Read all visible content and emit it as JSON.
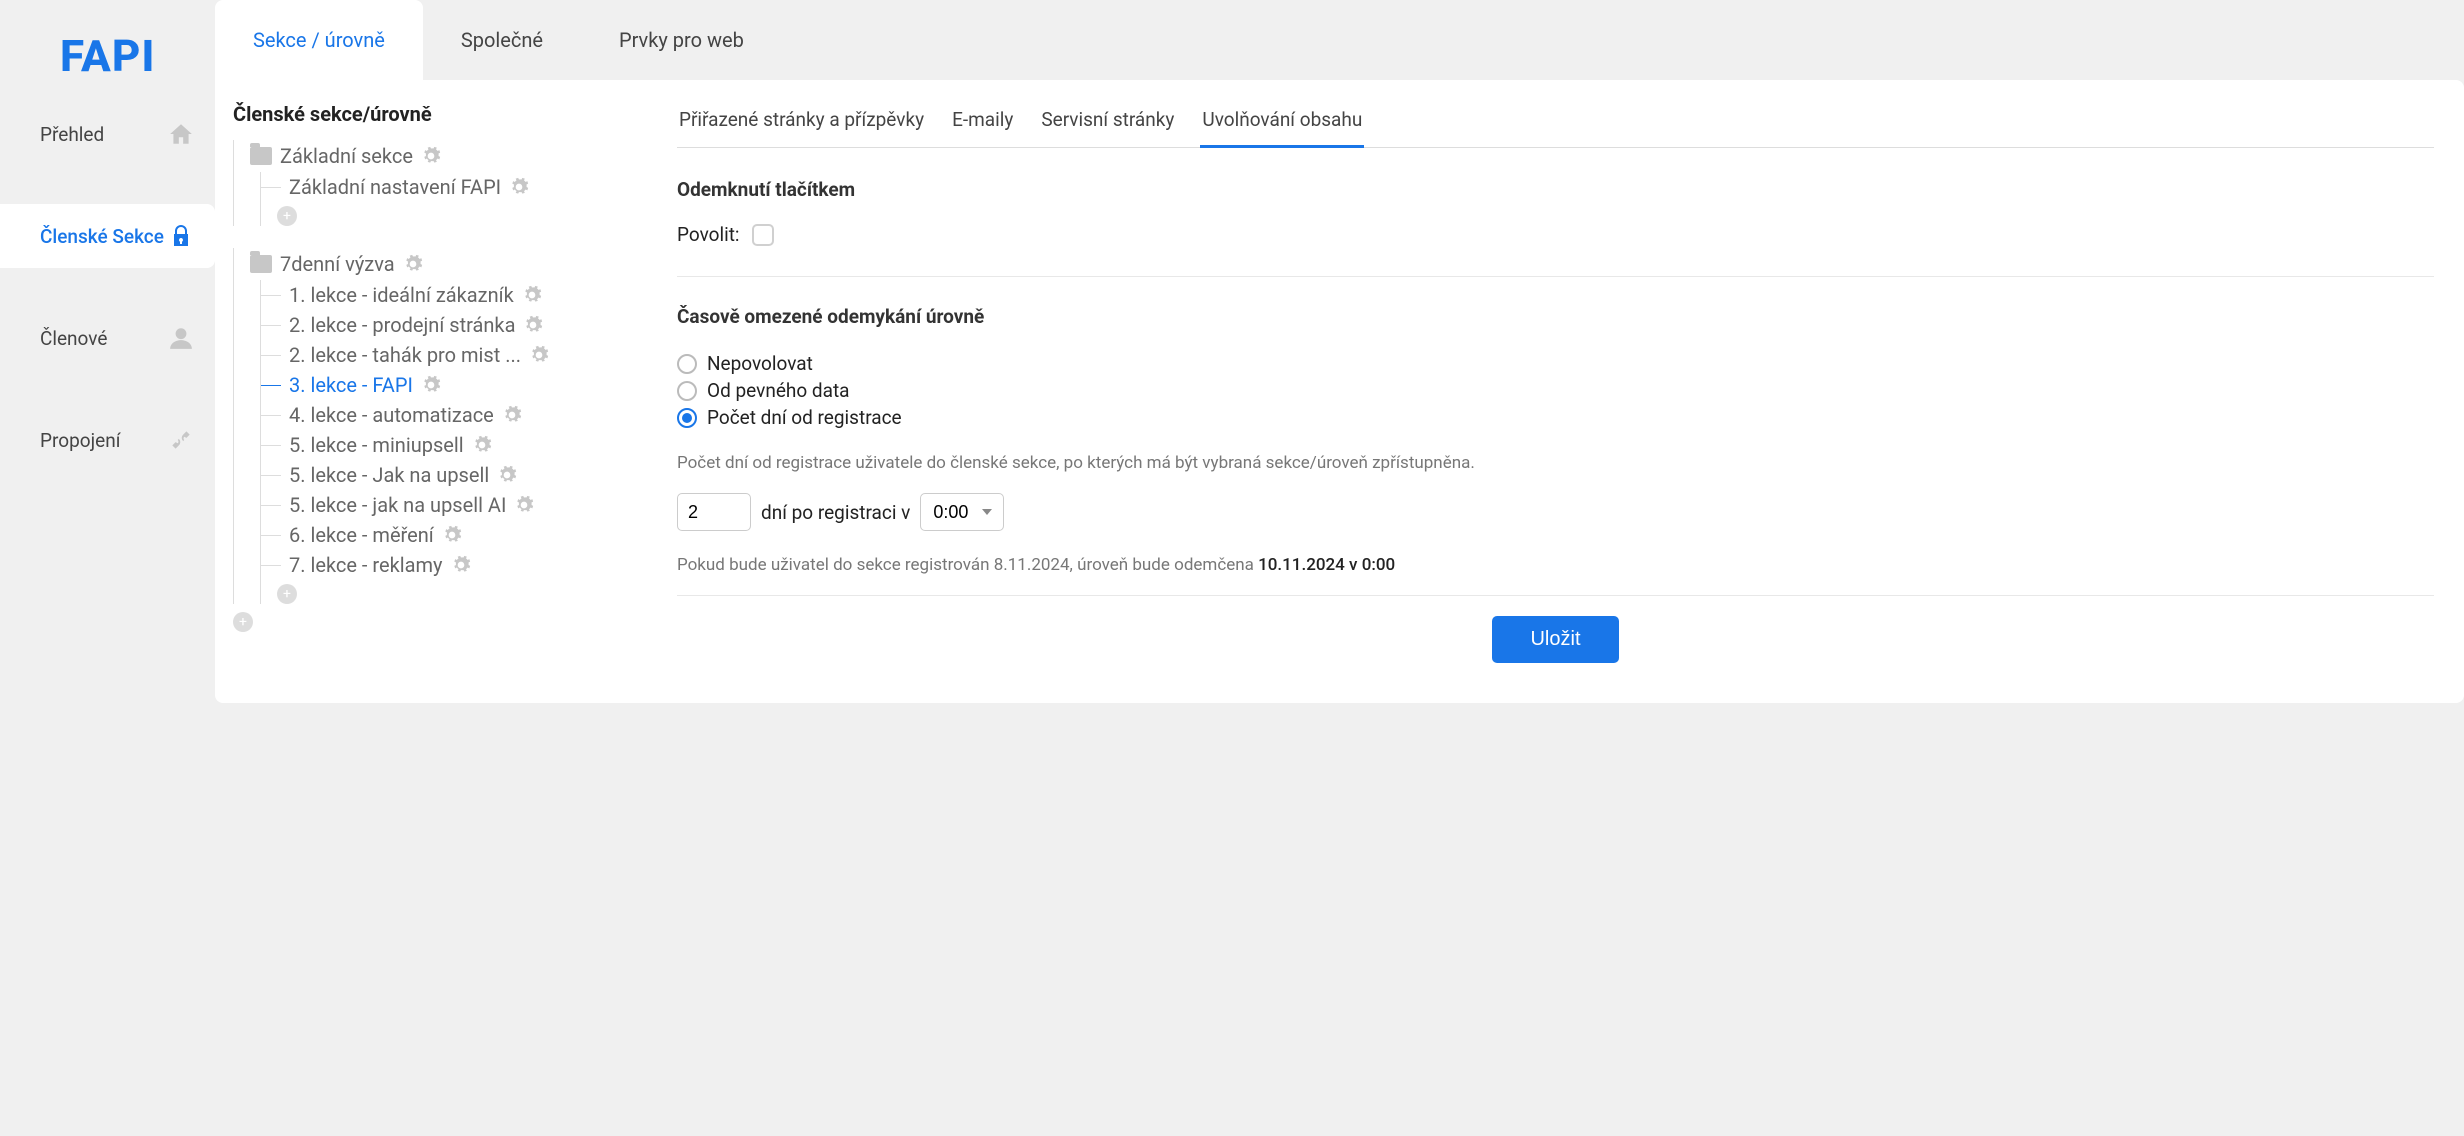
{
  "logo": "FAPI",
  "sidebar": {
    "items": [
      {
        "label": "Přehled",
        "icon": "home-icon",
        "active": false
      },
      {
        "label": "Členské Sekce",
        "icon": "lock-icon",
        "active": true
      },
      {
        "label": "Členové",
        "icon": "user-icon",
        "active": false
      },
      {
        "label": "Propojení",
        "icon": "plug-icon",
        "active": false
      }
    ]
  },
  "top_tabs": [
    {
      "label": "Sekce / úrovně",
      "active": true
    },
    {
      "label": "Společné",
      "active": false
    },
    {
      "label": "Prvky pro web",
      "active": false
    }
  ],
  "tree": {
    "title": "Členské sekce/úrovně",
    "groups": [
      {
        "folder": "Základní sekce",
        "children": [
          {
            "label": "Základní nastavení FAPI",
            "active": false
          }
        ]
      },
      {
        "folder": "7denní výzva",
        "children": [
          {
            "label": "1. lekce - ideální zákazník",
            "active": false
          },
          {
            "label": "2. lekce - prodejní stránka",
            "active": false
          },
          {
            "label": "2. lekce - tahák pro mist ...",
            "active": false
          },
          {
            "label": "3. lekce - FAPI",
            "active": true
          },
          {
            "label": "4. lekce - automatizace",
            "active": false
          },
          {
            "label": "5. lekce - miniupsell",
            "active": false
          },
          {
            "label": "5. lekce - Jak na upsell",
            "active": false
          },
          {
            "label": "5. lekce - jak na upsell AI",
            "active": false
          },
          {
            "label": "6. lekce - měření",
            "active": false
          },
          {
            "label": "7. lekce - reklamy",
            "active": false
          }
        ]
      }
    ]
  },
  "sub_tabs": [
    {
      "label": "Přiřazené stránky a přízpěvky",
      "active": false
    },
    {
      "label": "E-maily",
      "active": false
    },
    {
      "label": "Servisní stránky",
      "active": false
    },
    {
      "label": "Uvolňování obsahu",
      "active": true
    }
  ],
  "unlock_button": {
    "heading": "Odemknutí tlačítkem",
    "enable_label": "Povolit:",
    "checked": false
  },
  "time_unlock": {
    "heading": "Časově omezené odemykání úrovně",
    "options": [
      {
        "label": "Nepovolovat",
        "checked": false
      },
      {
        "label": "Od pevného data",
        "checked": false
      },
      {
        "label": "Počet dní od registrace",
        "checked": true
      }
    ],
    "hint": "Počet dní od registrace uživatele do členské sekce, po kterých má být vybraná sekce/úroveň zpřístupněna.",
    "days_value": "2",
    "days_suffix": "dní po registraci v",
    "time_value": "0:00",
    "result_prefix": "Pokud bude uživatel do sekce registrován 8.11.2024, úroveň bude odemčena ",
    "result_strong": "10.11.2024 v 0:00"
  },
  "save_label": "Uložit"
}
